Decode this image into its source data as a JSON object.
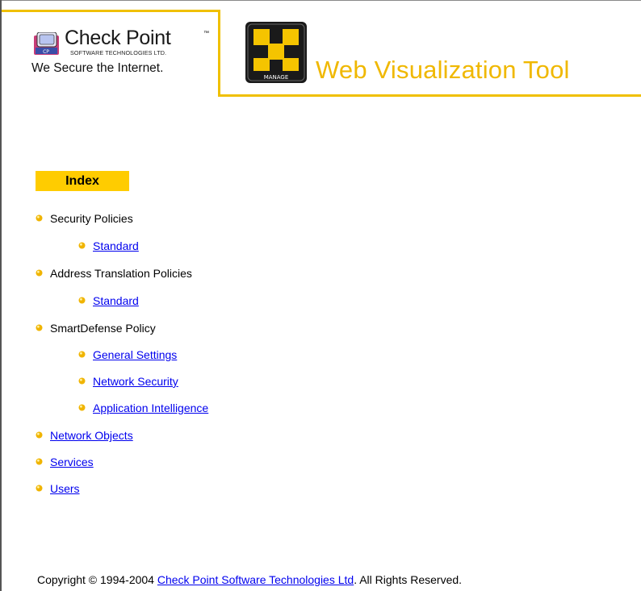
{
  "header": {
    "company_name": "Check Point",
    "company_trademark": "™",
    "company_subtitle": "SOFTWARE TECHNOLOGIES LTD.",
    "tagline": "We Secure the Internet.",
    "manage_icon_label": "MANAGE",
    "title": "Web Visualization Tool",
    "accent_color": "#f0c000"
  },
  "index": {
    "heading": "Index",
    "sections": [
      {
        "label": "Security Policies",
        "link": false,
        "children": [
          {
            "label": "Standard"
          }
        ]
      },
      {
        "label": "Address Translation Policies",
        "link": false,
        "children": [
          {
            "label": "Standard"
          }
        ]
      },
      {
        "label": "SmartDefense Policy",
        "link": false,
        "children": [
          {
            "label": "General Settings"
          },
          {
            "label": "Network Security"
          },
          {
            "label": "Application Intelligence"
          }
        ]
      },
      {
        "label": "Network Objects",
        "link": true
      },
      {
        "label": "Services",
        "link": true
      },
      {
        "label": "Users",
        "link": true
      }
    ]
  },
  "footer": {
    "prefix": "Copyright © 1994-2004 ",
    "link_text": "Check Point Software Technologies Ltd",
    "suffix": ". All Rights Reserved."
  }
}
